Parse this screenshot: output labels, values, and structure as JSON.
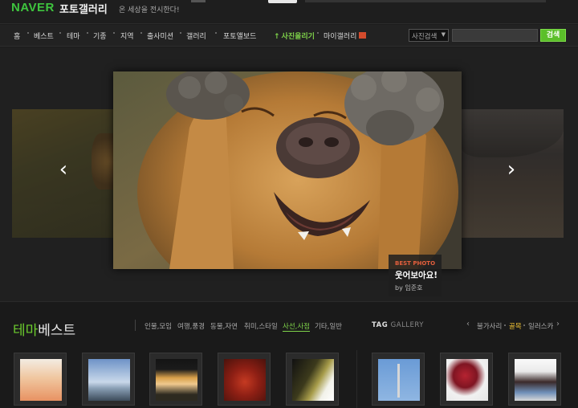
{
  "header": {
    "logo": "NAVER",
    "site_title": "포토갤러리",
    "tagline": "온 세상을 전시한다!"
  },
  "nav": {
    "items": [
      "홈",
      "베스트",
      "테마",
      "기종",
      "지역",
      "출사미션",
      "갤러리",
      "포토앨보드"
    ],
    "upload": "사진올리기",
    "my_gallery": "마이갤러리"
  },
  "search": {
    "select_label": "사진검색",
    "input_value": "",
    "button_label": "검색"
  },
  "featured": {
    "tag": "BEST PHOTO",
    "title": "웃어보아요!",
    "by_prefix": "by",
    "author": "임준호"
  },
  "theme_best": {
    "title_accent": "테마",
    "title_rest": "베스트",
    "categories": [
      "인물,모임",
      "여행,풍경",
      "동물,자연",
      "취미,스타일",
      "사선,사점",
      "기타,일반"
    ],
    "active_category": "사선,사점"
  },
  "tag_gallery": {
    "title_bold": "TAG",
    "title_dim": "GALLERY",
    "tags": [
      "불가사리",
      "골목",
      "일러스카"
    ],
    "active_tag": "골목"
  },
  "colors": {
    "accent_green": "#6ccc2e",
    "search_button": "#5bbf2a",
    "best_photo_red": "#e45f3d",
    "tag_active": "#f4c534"
  },
  "icons": {
    "carousel_prev": "chevron-left-icon",
    "carousel_next": "chevron-right-icon",
    "upload": "arrow-up-icon",
    "select_caret": "caret-down-icon"
  }
}
